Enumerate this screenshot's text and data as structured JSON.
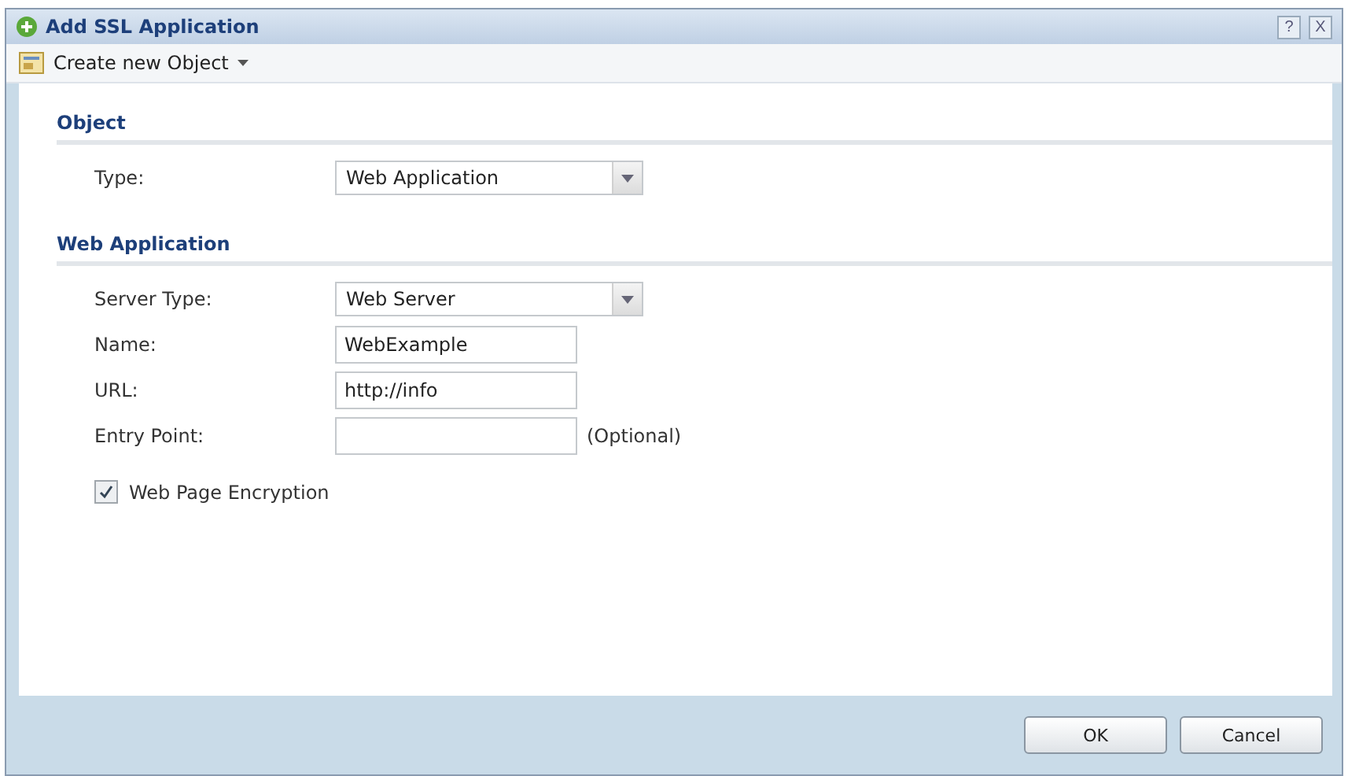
{
  "window": {
    "title": "Add SSL Application",
    "help": "?",
    "close": "X"
  },
  "toolbar": {
    "label": "Create new Object"
  },
  "sections": [
    {
      "title": "Object",
      "fields": [
        {
          "kind": "select",
          "label": "Type:",
          "value": "Web Application"
        }
      ]
    },
    {
      "title": "Web Application",
      "fields": [
        {
          "kind": "select",
          "label": "Server Type:",
          "value": "Web Server"
        },
        {
          "kind": "text",
          "label": "Name:",
          "value": "WebExample"
        },
        {
          "kind": "text",
          "label": "URL:",
          "value": "http://info"
        },
        {
          "kind": "text",
          "label": "Entry Point:",
          "note": "(Optional)"
        },
        {
          "kind": "checkbox",
          "label": "Web Page Encryption",
          "checked": true
        }
      ]
    }
  ],
  "buttons": [
    "OK",
    "Cancel"
  ]
}
